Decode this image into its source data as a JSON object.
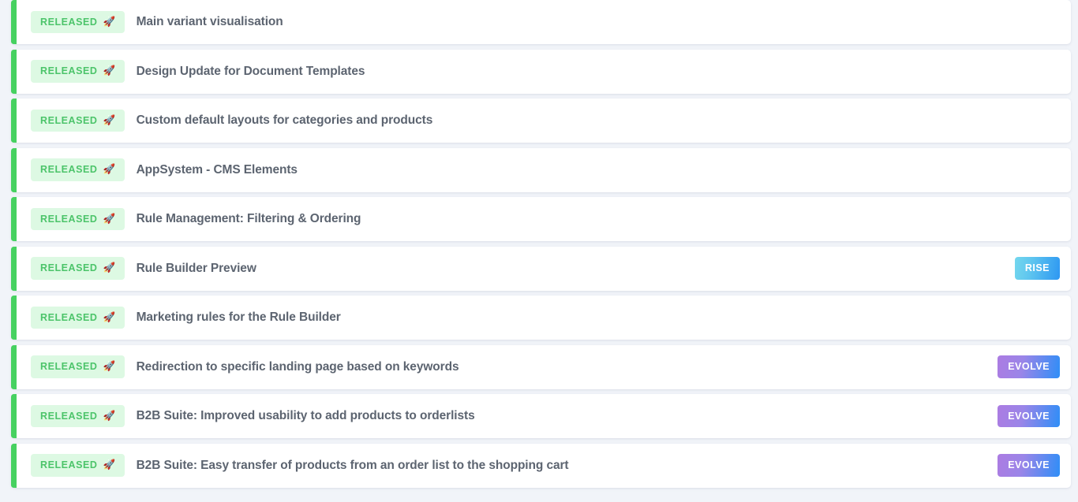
{
  "page": {
    "background_color": "#f1f4f9",
    "row_background_color": "#ffffff",
    "status_accent_color": "#46d160",
    "title_color": "#5c6470"
  },
  "badges": {
    "released": {
      "label": "RELEASED",
      "icon": "rocket-icon",
      "icon_glyph": "🚀",
      "text_color": "#4cc46a",
      "background_color": "#ddf9e3"
    },
    "products": {
      "rise": {
        "label": "RISE",
        "gradient_from": "#74d7ee",
        "gradient_to": "#2d97f2",
        "text_color": "#ffffff"
      },
      "evolve": {
        "label": "EVOLVE",
        "gradient_from": "#ac7ce2",
        "gradient_to": "#2e8ef7",
        "text_color": "#ffffff"
      }
    }
  },
  "rows": [
    {
      "status": "RELEASED",
      "title": "Main variant visualisation",
      "product": ""
    },
    {
      "status": "RELEASED",
      "title": "Design Update for Document Templates",
      "product": ""
    },
    {
      "status": "RELEASED",
      "title": "Custom default layouts for categories and products",
      "product": ""
    },
    {
      "status": "RELEASED",
      "title": "AppSystem - CMS Elements",
      "product": ""
    },
    {
      "status": "RELEASED",
      "title": "Rule Management: Filtering & Ordering",
      "product": ""
    },
    {
      "status": "RELEASED",
      "title": "Rule Builder Preview",
      "product": "RISE"
    },
    {
      "status": "RELEASED",
      "title": "Marketing rules for the Rule Builder",
      "product": ""
    },
    {
      "status": "RELEASED",
      "title": "Redirection to specific landing page based on keywords",
      "product": "EVOLVE"
    },
    {
      "status": "RELEASED",
      "title": "B2B Suite: Improved usability to add products to orderlists",
      "product": "EVOLVE"
    },
    {
      "status": "RELEASED",
      "title": "B2B Suite: Easy transfer of products from an order list to the shopping cart",
      "product": "EVOLVE"
    }
  ]
}
